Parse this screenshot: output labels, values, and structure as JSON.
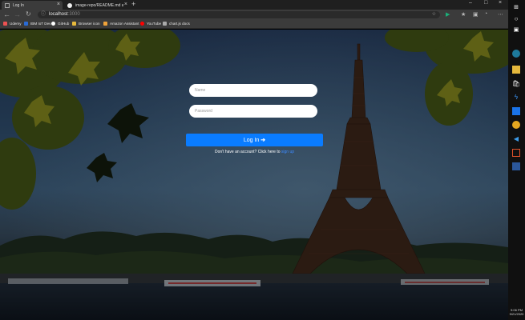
{
  "tabs": [
    {
      "label": "Log In",
      "active": true
    },
    {
      "label": "image-repo/README.md at ma...",
      "active": false
    }
  ],
  "address_bar": {
    "host": "localhost",
    "port": ":3000"
  },
  "bookmarks": [
    {
      "label": "Udemy",
      "icon": "udemy-icon",
      "color": "#ec5252"
    },
    {
      "label": "IBM IoT Dev",
      "icon": "ibm-icon",
      "color": "#2a6bd6"
    },
    {
      "label": "GitHub",
      "icon": "github-icon",
      "color": "#ffffff"
    },
    {
      "label": "Browser icon",
      "icon": "folder-icon",
      "color": "#e7b93c"
    },
    {
      "label": "Amazon Assistant",
      "icon": "amazon-icon",
      "color": "#f0a33a"
    },
    {
      "label": "YouTube",
      "icon": "youtube-icon",
      "color": "#ff0000"
    },
    {
      "label": "chart.js docs",
      "icon": "chartjs-icon",
      "color": "#cccccc"
    }
  ],
  "form": {
    "name_placeholder": "Name",
    "password_placeholder": "Password",
    "login_label": "Log In",
    "login_arrow": "➔",
    "signup_prompt": "Don't have an account? Click here to",
    "signup_link": "sign up"
  },
  "colors": {
    "primary_button": "#0a7cff",
    "link": "#3d8bff"
  },
  "taskbar": {
    "time": "9:06 PM",
    "date": "9/21/2020"
  }
}
